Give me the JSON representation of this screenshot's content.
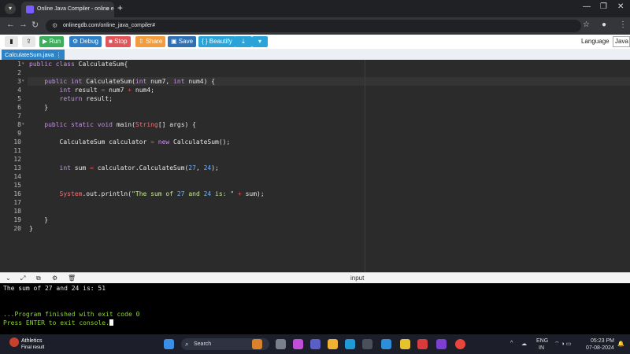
{
  "browser": {
    "tab_title": "Online Java Compiler - online e",
    "tab_close": "×",
    "new_tab": "+",
    "url": "onlinegdb.com/online_java_compiler#",
    "window_controls": [
      "—",
      "❐",
      "✕"
    ]
  },
  "toolbar": {
    "run": "Run",
    "debug": "Debug",
    "stop": "Stop",
    "share": "Share",
    "save": "Save",
    "beautify": "{ } Beautify",
    "language_label": "Language",
    "language_value": "Java",
    "colors": {
      "run": "#3dae5c",
      "debug": "#2e7fc5",
      "stop": "#e0565b",
      "share": "#f39c3d",
      "save": "#2f6fb3",
      "beautify": "#2aa3d9"
    }
  },
  "file_tab": {
    "name": "CalculateSum.java",
    "menu": "⋮"
  },
  "editor": {
    "line_numbers": [
      "1",
      "2",
      "3",
      "4",
      "5",
      "6",
      "7",
      "8",
      "9",
      "10",
      "11",
      "12",
      "13",
      "14",
      "15",
      "16",
      "17",
      "18",
      "19",
      "20"
    ],
    "active_line": "3",
    "lines": [
      "public class CalculateSum{",
      "",
      "    public int CalculateSum(int num7, int num4) {",
      "        int result = num7 + num4;",
      "        return result;",
      "    }",
      "",
      "    public static void main(String[] args) {",
      "",
      "        CalculateSum calculator = new CalculateSum();",
      "",
      "",
      "        int sum = calculator.CalculateSum(27, 24);",
      "",
      "",
      "        System.out.println(\"The sum of 27 and 24 is: \" + sum);",
      "",
      "",
      "    }",
      "}"
    ]
  },
  "console": {
    "input_label": "input",
    "output": "The sum of 27 and 24 is: 51",
    "finished": "...Program finished with exit code 0",
    "press_enter": "Press ENTER to exit console."
  },
  "taskbar": {
    "widget_title": "Athletics",
    "widget_sub": "Final result",
    "search_placeholder": "Search",
    "lang_top": "ENG",
    "lang_bottom": "IN",
    "time": "05:23 PM",
    "date": "07-08-2024"
  }
}
